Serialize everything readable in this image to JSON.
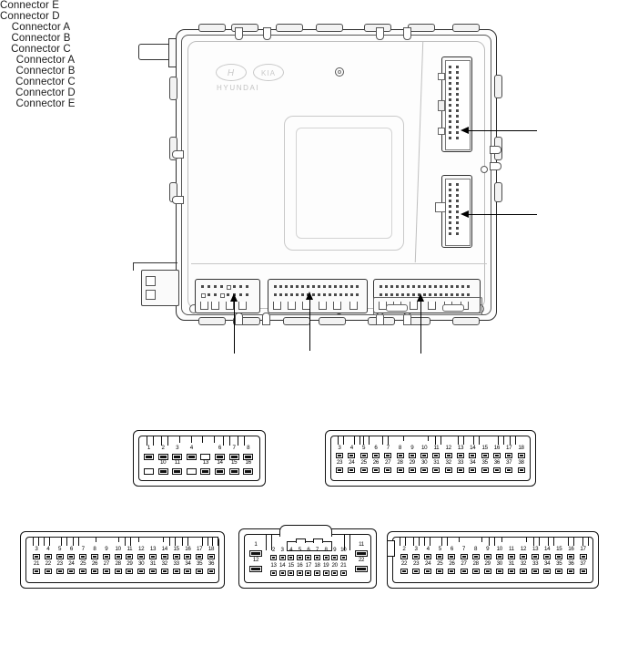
{
  "diagram": {
    "title_text": "",
    "brand_primary": "HYUNDAI",
    "brand_secondary": "KIA",
    "brand_wordmark": "HYUNDAI",
    "colors": {
      "line": "#111111",
      "shell": "#2b2b2b",
      "brand_gray": "#c2c2c2",
      "background": "#ffffff"
    }
  },
  "module_callouts": [
    {
      "id": "callout-connector-e",
      "label": "Connector E"
    },
    {
      "id": "callout-connector-d",
      "label": "Connector D"
    },
    {
      "id": "callout-connector-a",
      "label": "Connector A"
    },
    {
      "id": "callout-connector-b",
      "label": "Connector B"
    },
    {
      "id": "callout-connector-c",
      "label": "Connector C"
    }
  ],
  "connectors": [
    {
      "id": "connector-a",
      "caption": "Connector A",
      "top_row": [
        "1",
        "2",
        "3",
        "4",
        "",
        "6",
        "7",
        "8"
      ],
      "bottom_row": [
        "",
        "10",
        "11",
        "",
        "13",
        "14",
        "15",
        "16"
      ],
      "pin_count": 16
    },
    {
      "id": "connector-b",
      "caption": "Connector B",
      "top_row": [
        "3",
        "4",
        "5",
        "6",
        "7",
        "8",
        "9",
        "10",
        "11",
        "12",
        "13",
        "14",
        "15",
        "16",
        "17",
        "18"
      ],
      "bottom_row": [
        "23",
        "24",
        "25",
        "26",
        "27",
        "28",
        "29",
        "30",
        "31",
        "32",
        "33",
        "34",
        "35",
        "36",
        "37",
        "38"
      ],
      "pin_count": 32
    },
    {
      "id": "connector-c",
      "caption": "Connector C",
      "top_row": [
        "3",
        "4",
        "5",
        "6",
        "7",
        "8",
        "9",
        "10",
        "11",
        "12",
        "13",
        "14",
        "15",
        "16",
        "17",
        "18"
      ],
      "bottom_row": [
        "21",
        "22",
        "23",
        "24",
        "25",
        "26",
        "27",
        "28",
        "29",
        "30",
        "31",
        "32",
        "33",
        "34",
        "35",
        "36"
      ],
      "pin_count": 32
    },
    {
      "id": "connector-d",
      "caption": "Connector D",
      "top_left_big": "1",
      "top_right_big": "11",
      "bottom_left_big": "12",
      "bottom_right_big": "22",
      "top_row": [
        "2",
        "3",
        "4",
        "5",
        "6",
        "7",
        "8",
        "9",
        "10"
      ],
      "bottom_row": [
        "13",
        "14",
        "15",
        "16",
        "17",
        "18",
        "19",
        "20",
        "21"
      ],
      "pin_count": 22
    },
    {
      "id": "connector-e",
      "caption": "Connector E",
      "top_row": [
        "2",
        "3",
        "4",
        "5",
        "6",
        "7",
        "8",
        "9",
        "10",
        "11",
        "12",
        "13",
        "14",
        "15",
        "16",
        "17"
      ],
      "bottom_row": [
        "22",
        "23",
        "24",
        "25",
        "26",
        "27",
        "28",
        "29",
        "30",
        "31",
        "32",
        "33",
        "34",
        "35",
        "36",
        "37"
      ],
      "pin_count": 32
    }
  ]
}
